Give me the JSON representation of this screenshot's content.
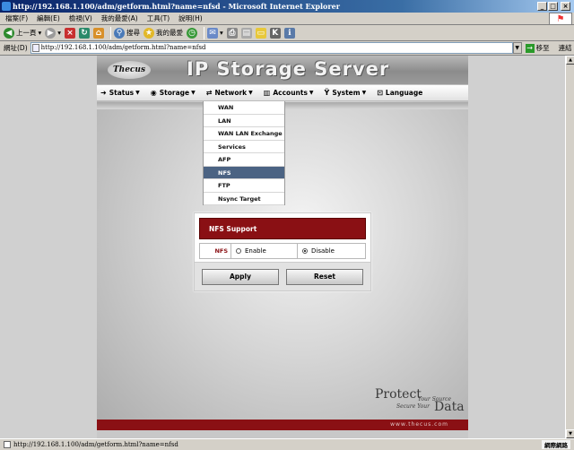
{
  "window": {
    "title": "http://192.168.1.100/adm/getform.html?name=nfsd - Microsoft Internet Explorer",
    "controls": {
      "minimize": "_",
      "maximize": "□",
      "close": "×"
    }
  },
  "menubar": [
    "檔案(F)",
    "編輯(E)",
    "檢視(V)",
    "我的最愛(A)",
    "工具(T)",
    "說明(H)"
  ],
  "toolbar": {
    "back_label": "上一頁",
    "search_label": "搜尋",
    "favorites_label": "我的最愛"
  },
  "address": {
    "label": "網址(D)",
    "url": "http://192.168.1.100/adm/getform.html?name=nfsd",
    "go_label": "移至",
    "links_label": "連結"
  },
  "header": {
    "logo": "Thecus",
    "brand": "IP Storage Server"
  },
  "nav": [
    {
      "label": "Status",
      "icon": "status-icon"
    },
    {
      "label": "Storage",
      "icon": "storage-icon"
    },
    {
      "label": "Network",
      "icon": "network-icon"
    },
    {
      "label": "Accounts",
      "icon": "accounts-icon"
    },
    {
      "label": "System",
      "icon": "system-icon"
    },
    {
      "label": "Language",
      "icon": "language-icon"
    }
  ],
  "network_menu": {
    "items": [
      "WAN",
      "LAN",
      "WAN LAN Exchange",
      "Services",
      "AFP",
      "NFS",
      "FTP",
      "Nsync Target"
    ],
    "selected": "NFS"
  },
  "nfs_panel": {
    "title": "NFS Support",
    "field_label": "NFS",
    "options": [
      {
        "label": "Enable",
        "checked": false
      },
      {
        "label": "Disable",
        "checked": true
      }
    ],
    "apply_label": "Apply",
    "reset_label": "Reset"
  },
  "tagline": {
    "protect": "Protect",
    "your_source": "Your Source",
    "secure_your": "Secure Your",
    "data": "Data"
  },
  "footer_url": "www.thecus.com",
  "status": {
    "text": "http://192.168.1.100/adm/getform.html?name=nfsd",
    "zone": "網際網路"
  },
  "colors": {
    "accent_red": "#8a1014",
    "menu_selected": "#4b6383"
  }
}
